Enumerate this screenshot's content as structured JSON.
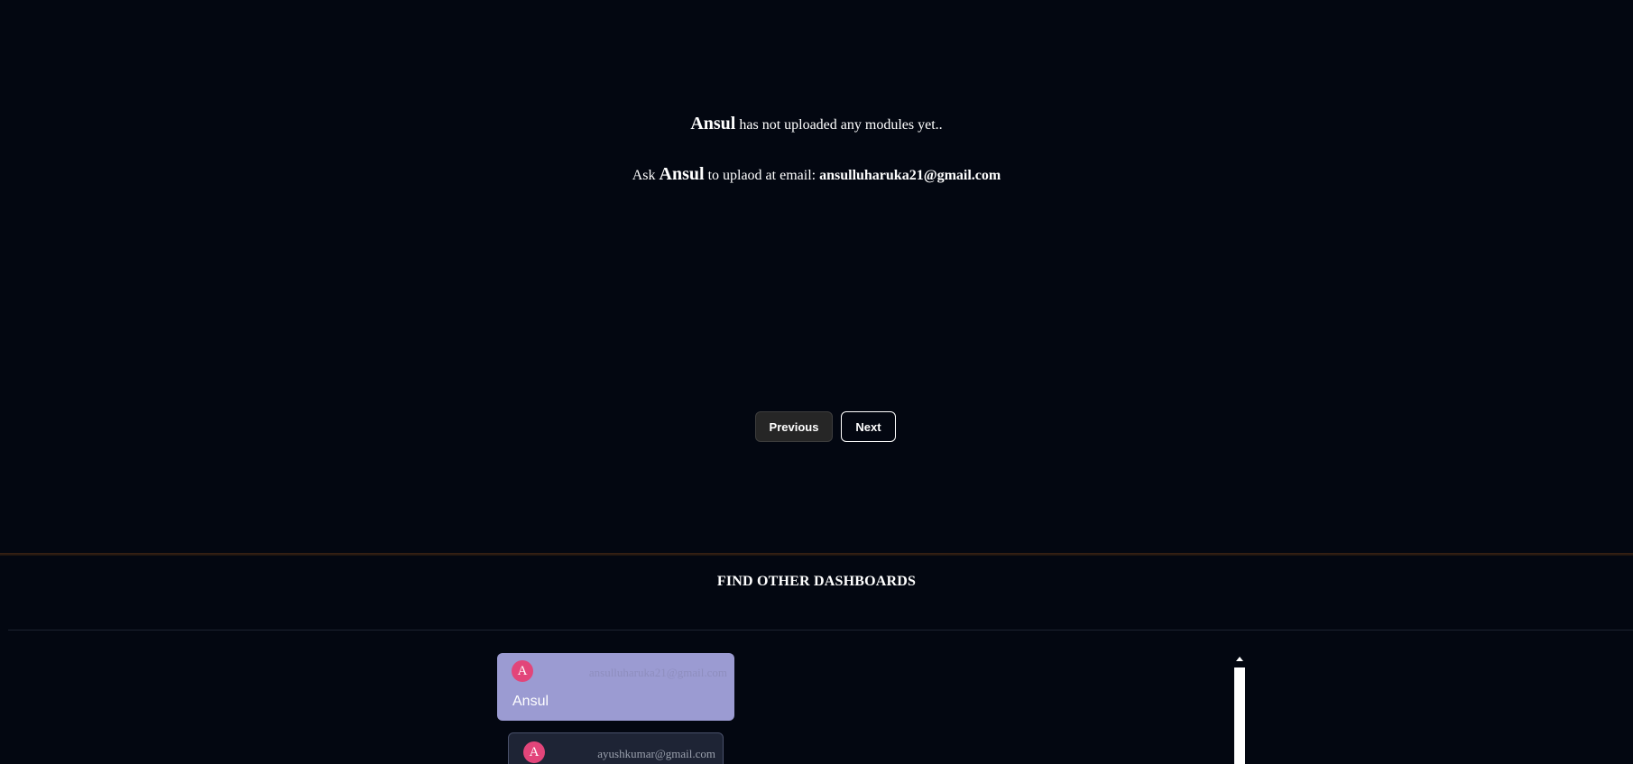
{
  "notice": {
    "owner_name": "Ansul",
    "line1_suffix": " has not uploaded any modules yet..",
    "line2_prefix": "Ask ",
    "line2_name": "Ansul",
    "line2_middle": " to uplaod at email: ",
    "email": "ansulluharuka21@gmail.com"
  },
  "pagination": {
    "previous_label": "Previous",
    "next_label": "Next"
  },
  "dashboards": {
    "title": "FIND OTHER DASHBOARDS",
    "cards": [
      {
        "avatar_letter": "A",
        "email": "ansulluharuka21@gmail.com",
        "name": "Ansul",
        "selected": true
      },
      {
        "avatar_letter": "A",
        "email": "ayushkumar@gmail.com",
        "name": "",
        "selected": false
      }
    ]
  },
  "colors": {
    "background": "#030711",
    "active_card": "#9b9bd2",
    "avatar": "#e2457a",
    "card_dark": "#1e2435"
  },
  "icons": {
    "scroll_up": "scroll-up-arrow-icon"
  }
}
